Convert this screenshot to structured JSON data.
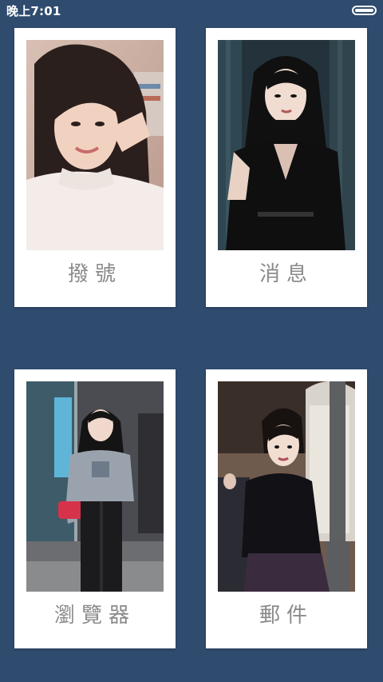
{
  "status_bar": {
    "time": "晚上7:01",
    "battery_icon": "battery-icon"
  },
  "tiles": [
    {
      "id": "phone",
      "label": "撥號",
      "photo_icon": "portrait-photo"
    },
    {
      "id": "message",
      "label": "消息",
      "photo_icon": "portrait-photo"
    },
    {
      "id": "browser",
      "label": "瀏覽器",
      "photo_icon": "portrait-photo"
    },
    {
      "id": "mail",
      "label": "郵件",
      "photo_icon": "portrait-photo"
    }
  ],
  "colors": {
    "background": "#2f4b6e",
    "card": "#ffffff",
    "label": "#8a8a8a"
  }
}
